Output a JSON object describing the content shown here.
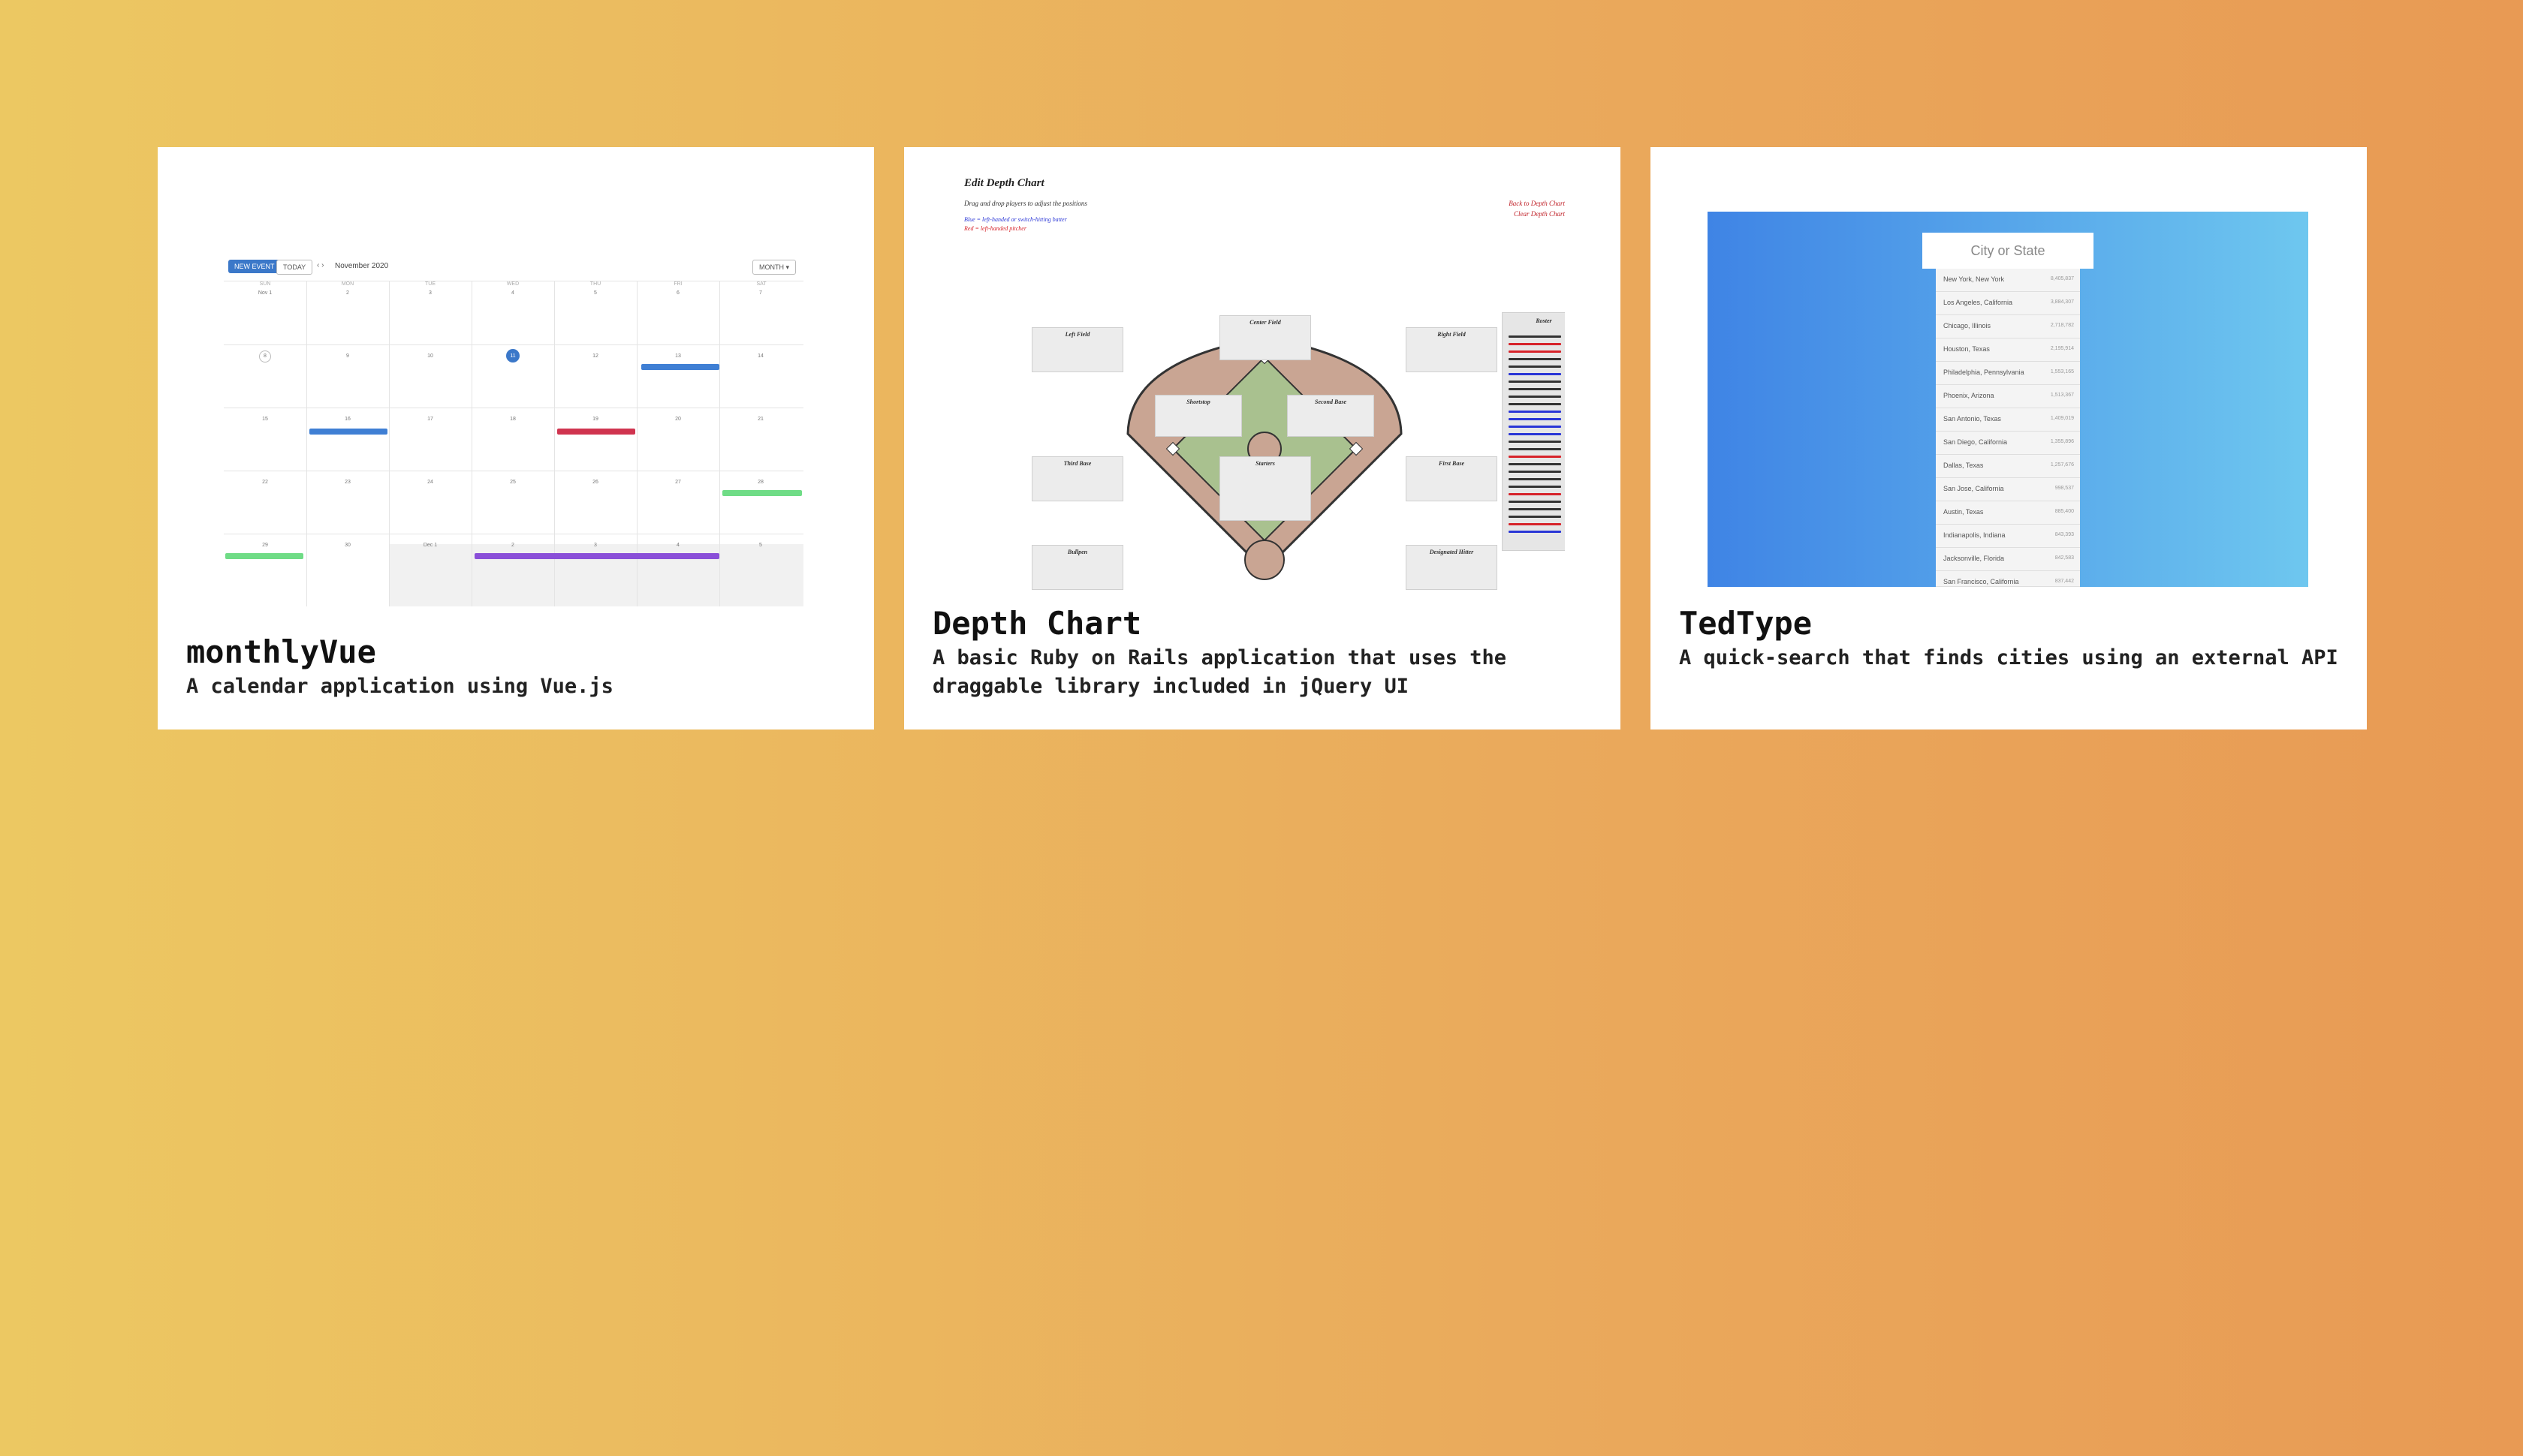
{
  "projects": [
    {
      "title": "monthlyVue",
      "description": "A calendar application using Vue.js",
      "thumb": {
        "new_event": "NEW EVENT",
        "today": "TODAY",
        "nav": "‹ ›",
        "month": "November 2020",
        "view": "MONTH ▾",
        "day_heads": [
          "SUN",
          "MON",
          "TUE",
          "WED",
          "THU",
          "FRI",
          "SAT"
        ],
        "rows": [
          [
            "Nov 1",
            "2",
            "3",
            "4",
            "5",
            "6",
            "7"
          ],
          [
            "8",
            "9",
            "10",
            "11",
            "12",
            "13",
            "14"
          ],
          [
            "15",
            "16",
            "17",
            "18",
            "19",
            "20",
            "21"
          ],
          [
            "22",
            "23",
            "24",
            "25",
            "26",
            "27",
            "28"
          ],
          [
            "29",
            "30",
            "Dec 1",
            "2",
            "3",
            "4",
            "5"
          ]
        ]
      }
    },
    {
      "title": "Depth Chart",
      "description": "A basic Ruby on Rails application that uses the draggable library included in jQuery UI",
      "thumb": {
        "title": "Edit Depth Chart",
        "subtitle": "Drag and drop players to adjust the positions",
        "legend_blue": "Blue = left-handed or switch-hitting batter",
        "legend_red": "Red = left-handed pitcher",
        "back_link": "Back to Depth Chart",
        "clear_link": "Clear Depth Chart",
        "positions": {
          "left_field": "Left Field",
          "center_field": "Center Field",
          "right_field": "Right Field",
          "shortstop": "Shortstop",
          "second_base": "Second Base",
          "third_base": "Third Base",
          "pitcher": "Starters",
          "first_base": "First Base",
          "bullpen": "Bullpen",
          "designated_hitter": "Designated Hitter",
          "roster": "Roster"
        }
      }
    },
    {
      "title": "TedType",
      "description": "A quick-search that finds cities using an external API",
      "thumb": {
        "placeholder": "City or State",
        "cities": [
          {
            "name": "New York, New York",
            "pop": "8,405,837"
          },
          {
            "name": "Los Angeles, California",
            "pop": "3,884,307"
          },
          {
            "name": "Chicago, Illinois",
            "pop": "2,718,782"
          },
          {
            "name": "Houston, Texas",
            "pop": "2,195,914"
          },
          {
            "name": "Philadelphia, Pennsylvania",
            "pop": "1,553,165"
          },
          {
            "name": "Phoenix, Arizona",
            "pop": "1,513,367"
          },
          {
            "name": "San Antonio, Texas",
            "pop": "1,409,019"
          },
          {
            "name": "San Diego, California",
            "pop": "1,355,896"
          },
          {
            "name": "Dallas, Texas",
            "pop": "1,257,676"
          },
          {
            "name": "San Jose, California",
            "pop": "998,537"
          },
          {
            "name": "Austin, Texas",
            "pop": "885,400"
          },
          {
            "name": "Indianapolis, Indiana",
            "pop": "843,393"
          },
          {
            "name": "Jacksonville, Florida",
            "pop": "842,583"
          },
          {
            "name": "San Francisco, California",
            "pop": "837,442"
          }
        ]
      }
    }
  ]
}
